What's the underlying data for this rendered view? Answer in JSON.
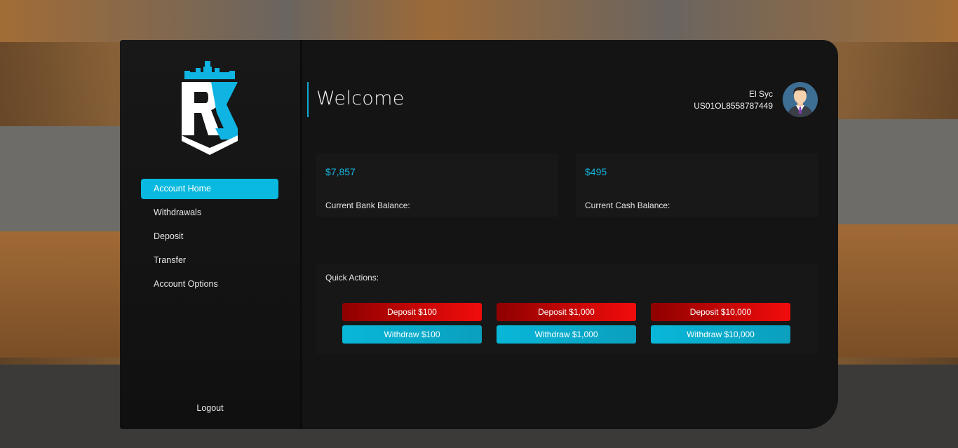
{
  "app": {
    "welcome_title": "Welcome",
    "logo_letters": "RK"
  },
  "user": {
    "name": "El Syc",
    "account_id": "US01OL8558787449"
  },
  "sidebar": {
    "items": [
      {
        "label": "Account Home",
        "active": true
      },
      {
        "label": "Withdrawals",
        "active": false
      },
      {
        "label": "Deposit",
        "active": false
      },
      {
        "label": "Transfer",
        "active": false
      },
      {
        "label": "Account Options",
        "active": false
      }
    ],
    "logout_label": "Logout"
  },
  "balances": {
    "bank_amount": "$7,857",
    "bank_label": "Current Bank Balance:",
    "cash_amount": "$495",
    "cash_label": "Current Cash Balance:"
  },
  "quick_actions": {
    "title": "Quick Actions:",
    "deposit_buttons": [
      "Deposit $100",
      "Deposit $1,000",
      "Deposit $10,000"
    ],
    "withdraw_buttons": [
      "Withdraw $100",
      "Withdraw $1,000",
      "Withdraw $10,000"
    ]
  },
  "colors": {
    "accent": "#09b9df",
    "deposit_red": "#e00808",
    "panel_bg": "#141414"
  },
  "icons": {
    "logo": "rk-crown-logo",
    "avatar": "user-avatar-icon"
  }
}
